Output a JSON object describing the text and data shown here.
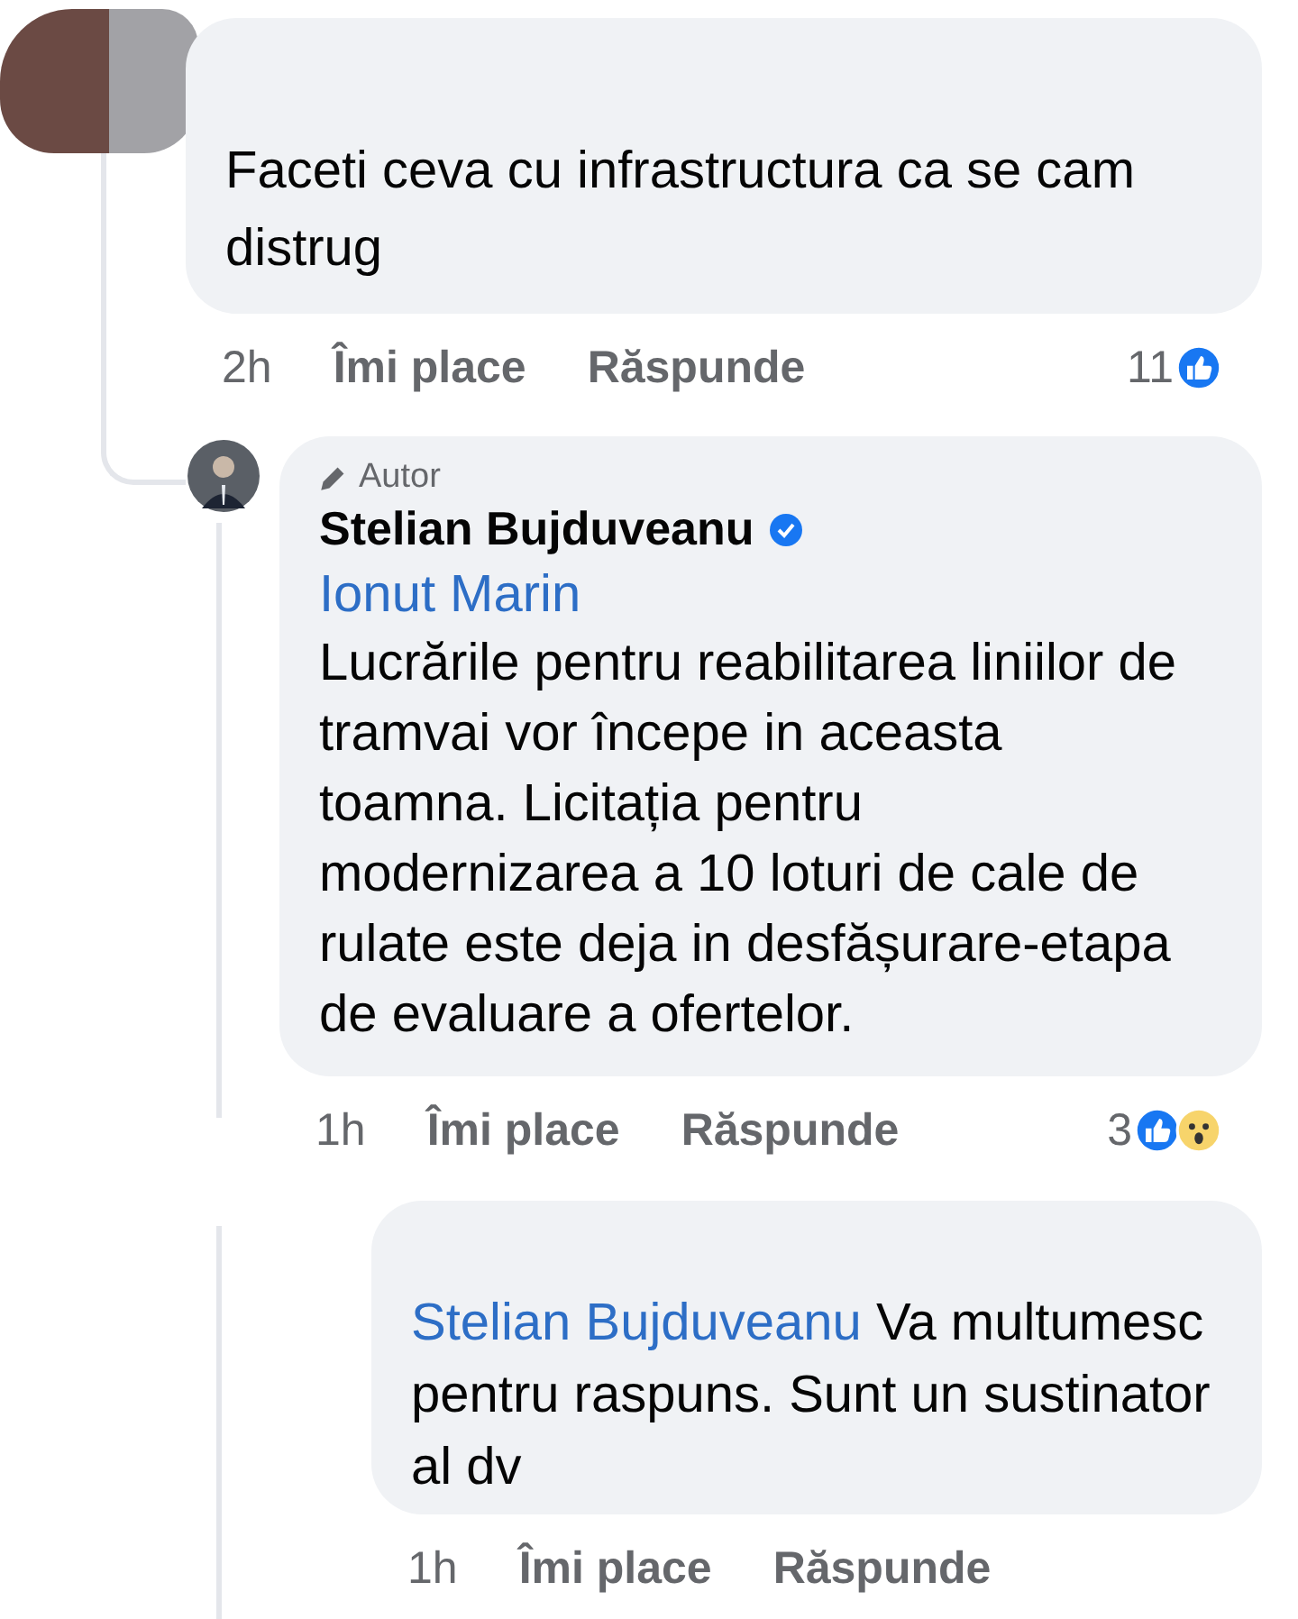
{
  "comments": [
    {
      "kind": "redacted",
      "text": "Faceti ceva cu infrastructura ca se cam distrug",
      "time": "2h",
      "like": "Îmi place",
      "reply": "Răspunde",
      "reactions": {
        "count": "11",
        "types": [
          {
            "kind": "like"
          }
        ]
      }
    },
    {
      "kind": "author",
      "badge": "Autor",
      "author": "Stelian Bujduveanu",
      "verified": true,
      "tagged": "Ionut Marin",
      "text": "Lucrările pentru reabilitarea liniilor de tramvai vor începe in aceasta toamna. Licitația pentru modernizarea a 10 loturi de cale de rulate este deja in desfășurare-etapa de evaluare a ofertelor.",
      "time": "1h",
      "like": "Îmi place",
      "reply": "Răspunde",
      "reactions": {
        "count": "3",
        "types": [
          {
            "kind": "like"
          },
          {
            "kind": "wow"
          }
        ]
      }
    },
    {
      "kind": "reply",
      "mention": "Stelian Bujduveanu",
      "text": "Va multumesc pentru raspuns. Sunt un sustinator al dv",
      "time": "1h",
      "like": "Îmi place",
      "reply": "Răspunde"
    }
  ]
}
